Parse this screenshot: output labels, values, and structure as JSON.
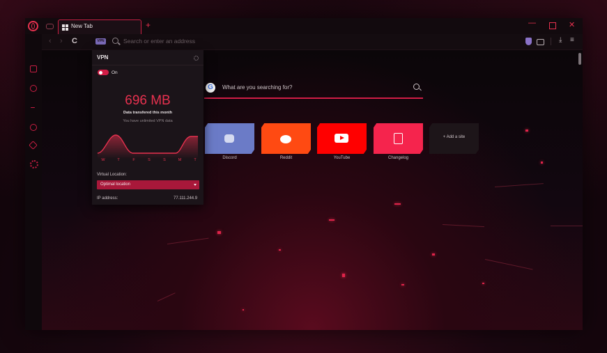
{
  "browser": {
    "tab": {
      "title": "New Tab"
    },
    "new_tab_symbol": "+",
    "window_controls": {
      "minimize": "—",
      "close": "✕"
    },
    "nav": {
      "back": "‹",
      "forward": "›",
      "reload": "C"
    },
    "vpn_badge": "VPN",
    "address_placeholder": "Search or enter an address",
    "toolbar_right": {
      "download": "⤓",
      "easy_setup": "≡"
    }
  },
  "main": {
    "search": {
      "placeholder": "What are you searching for?",
      "engine_letter": "G"
    },
    "speed_dials": [
      {
        "label": "Discord",
        "color": "#6b7bc7"
      },
      {
        "label": "Reddit",
        "color": "#ff4a12"
      },
      {
        "label": "YouTube",
        "color": "#ff0000"
      },
      {
        "label": "Changelog",
        "color": "#f5244d"
      }
    ],
    "add_site": "+ Add a site"
  },
  "vpn": {
    "title": "VPN",
    "toggle_label": "On",
    "data_amount": "696 MB",
    "data_caption": "Data transfered this month",
    "unlimited_text": "You have unlimited VPN data",
    "days": [
      "W",
      "T",
      "F",
      "S",
      "S",
      "M",
      "T"
    ],
    "location_label": "Virtual Location:",
    "location_value": "Optimal location",
    "ip_label": "IP address:",
    "ip_value": "77.111.244.9"
  },
  "colors": {
    "accent": "#e8314f",
    "accent_dark": "#a8183a",
    "background": "#0a0609"
  }
}
